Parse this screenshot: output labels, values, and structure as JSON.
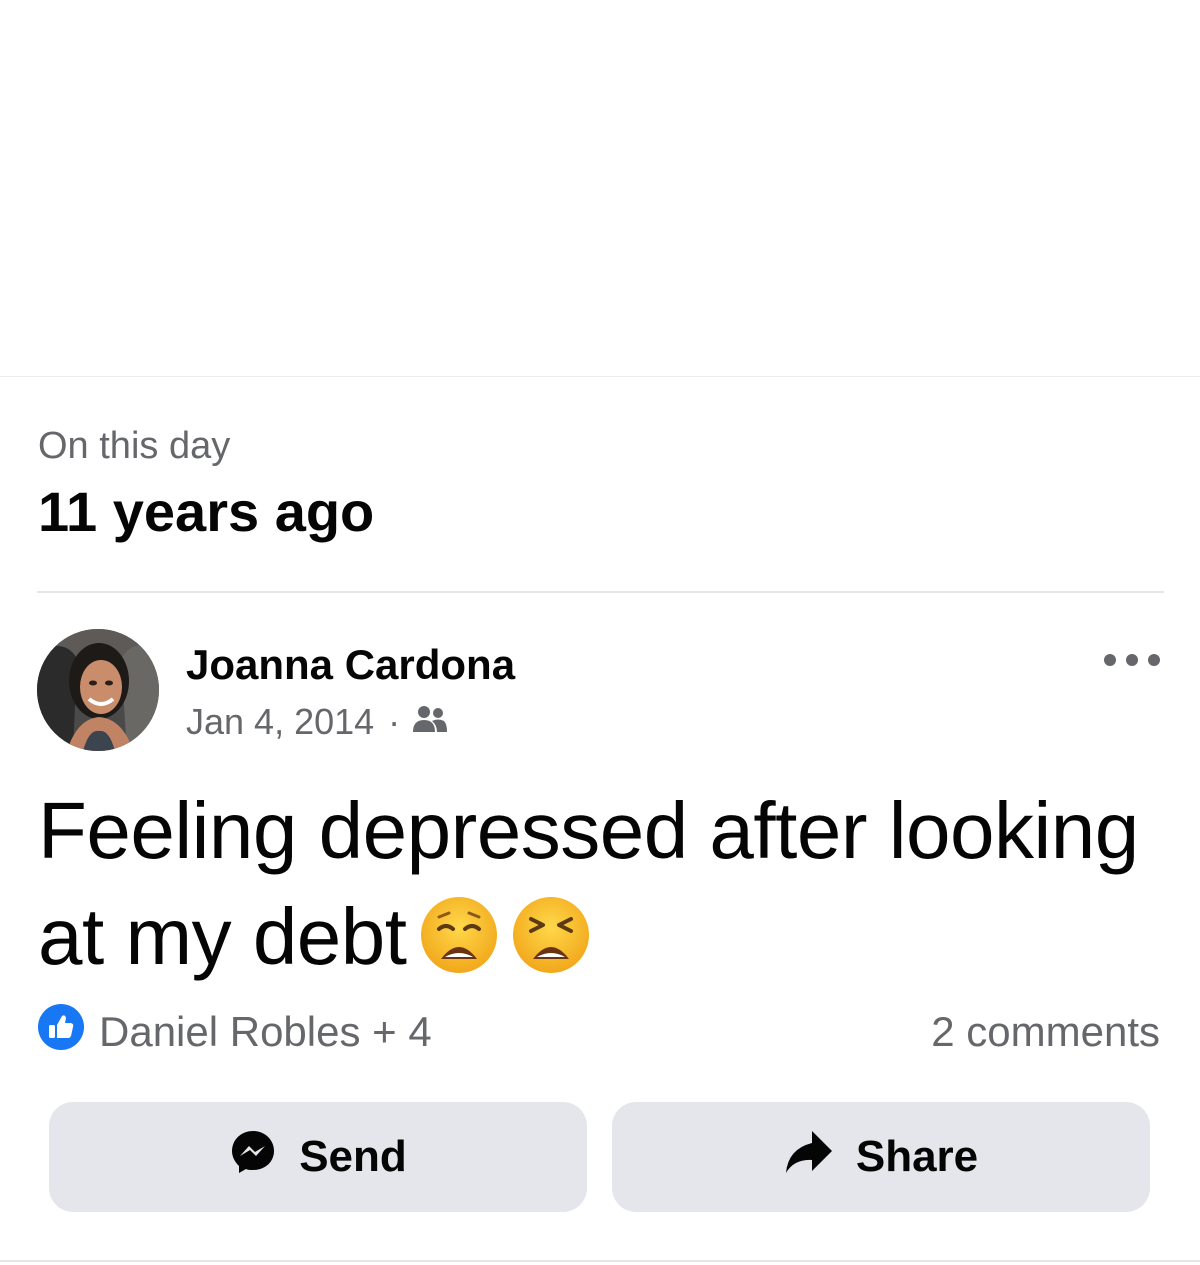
{
  "memory": {
    "label": "On this day",
    "years_ago": "11 years ago"
  },
  "post": {
    "author": "Joanna Cardona",
    "date": "Jan 4, 2014",
    "separator": "·",
    "audience_icon": "friends-icon",
    "text": "Feeling depressed after looking at my debt",
    "emojis": [
      "weary-face-emoji",
      "tired-face-emoji"
    ]
  },
  "engagement": {
    "reactions_text": "Daniel Robles + 4",
    "reaction_icon": "like-icon",
    "comments_text": "2 comments"
  },
  "actions": {
    "send_label": "Send",
    "send_icon": "messenger-icon",
    "share_label": "Share",
    "share_icon": "share-arrow-icon",
    "more_icon": "more-options-icon"
  },
  "colors": {
    "primary_text": "#050505",
    "secondary_text": "#65676b",
    "button_bg": "#e4e6eb",
    "like_blue": "#1877f2"
  }
}
